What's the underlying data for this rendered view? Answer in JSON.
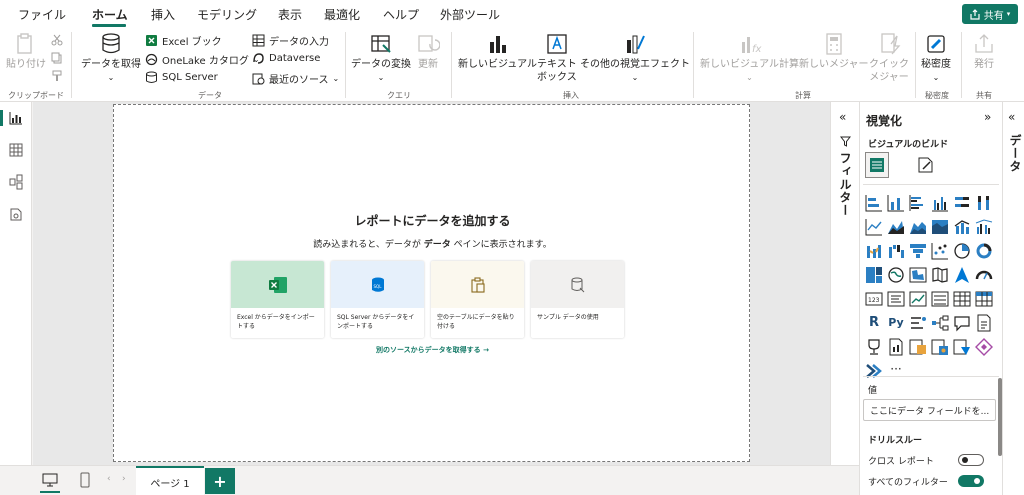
{
  "menu": {
    "tabs": [
      "ファイル",
      "ホーム",
      "挿入",
      "モデリング",
      "表示",
      "最適化",
      "ヘルプ",
      "外部ツール"
    ],
    "share_label": "共有"
  },
  "ribbon": {
    "clipboard": {
      "paste": "貼り付け",
      "group": "クリップボード"
    },
    "data": {
      "get_data": "データを取得",
      "excel": "Excel ブック",
      "onelake": "OneLake カタログ",
      "sql": "SQL Server",
      "enter_data": "データの入力",
      "dataverse": "Dataverse",
      "recent": "最近のソース",
      "group": "データ"
    },
    "query": {
      "transform": "データの変換",
      "refresh": "更新",
      "group": "クエリ"
    },
    "insert": {
      "new_visual": "新しいビジュアル",
      "textbox_line1": "テキスト",
      "textbox_line2": "ボックス",
      "more_visuals": "その他の視覚エフェクト",
      "group": "挿入"
    },
    "calc": {
      "new_visual_calc": "新しいビジュアル計算",
      "new_measure": "新しいメジャー",
      "quick_line1": "クイック",
      "quick_line2": "メジャー",
      "group": "計算"
    },
    "sensitivity": {
      "label": "秘密度",
      "group": "秘密度"
    },
    "share": {
      "publish": "発行",
      "group": "共有"
    }
  },
  "canvas": {
    "title": "レポートにデータを追加する",
    "subtitle_pre": "読み込まれると、データが ",
    "subtitle_bold": "データ",
    "subtitle_post": " ペインに表示されます。",
    "cards": [
      {
        "label": "Excel からデータをインポートする",
        "color": "#c7e7d3"
      },
      {
        "label": "SQL Server からデータをインポートする",
        "color": "#e6f0fb"
      },
      {
        "label": "空のテーブルにデータを貼り付ける",
        "color": "#fbf8ee"
      },
      {
        "label": "サンプル データの使用",
        "color": "#f1f0ef"
      }
    ],
    "get_more": "別のソースからデータを取得する →"
  },
  "bottombar": {
    "page_tab": "ページ 1",
    "add_label": "+"
  },
  "filters": {
    "label": "フィルター"
  },
  "visualizations": {
    "title": "視覚化",
    "build_label": "ビジュアルのビルド",
    "values_label": "値",
    "values_placeholder": "ここにデータ フィールドを...",
    "drillthrough_label": "ドリルスルー",
    "cross_report_label": "クロス レポート",
    "keep_filters_label": "すべてのフィルター",
    "cross_report_on": false,
    "keep_filters_on": true
  },
  "data_pane": {
    "label": "データ"
  },
  "colors": {
    "accent": "#117865"
  }
}
